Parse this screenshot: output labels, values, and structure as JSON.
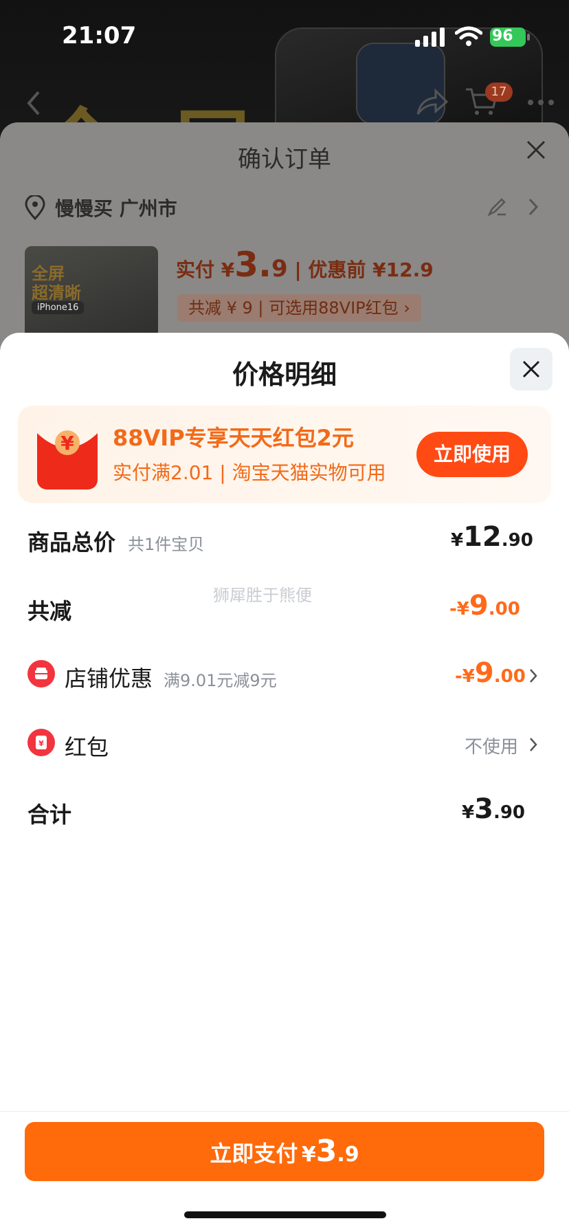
{
  "status_bar": {
    "time": "21:07",
    "battery": "96"
  },
  "background_header": {
    "big_text": "全屋",
    "cart_count": "17"
  },
  "order_sheet": {
    "title": "确认订单",
    "address": "慢慢买 广州市",
    "thumb_text": "全屏\n超清晰",
    "thumb_tag": "iPhone16",
    "paid_prefix": "实付 ¥",
    "paid_int": "3.",
    "paid_dec": "9",
    "before_discount": " | 优惠前 ¥12.9",
    "saved_chip": "共减 ¥ 9 | 可选用88VIP红包 ›"
  },
  "detail": {
    "title": "价格明细",
    "promo": {
      "title": "88VIP专享天天红包2元",
      "subtitle": "实付满2.01 | 淘宝天猫实物可用",
      "button": "立即使用"
    },
    "rows": {
      "total": {
        "label": "商品总价",
        "sub": "共1件宝贝",
        "sym": "¥",
        "int": "12",
        "dec": ".90"
      },
      "discount": {
        "label": "共减",
        "sym": "-¥",
        "int": "9",
        "dec": ".00"
      },
      "shop": {
        "label": "店铺优惠",
        "sub": "满9.01元减9元",
        "sym": "-¥",
        "int": "9",
        "dec": ".00"
      },
      "redpacket": {
        "label": "红包",
        "value": "不使用"
      },
      "sum": {
        "label": "合计",
        "sym": "¥",
        "int": "3",
        "dec": ".90"
      }
    },
    "watermark": "狮犀胜于熊便"
  },
  "pay_button": {
    "label": "立即支付",
    "sym": "¥",
    "int": "3",
    "dec": ".9"
  },
  "colors": {
    "accent": "#ff6a0a",
    "promo_button": "#ff4a14",
    "discount": "#ff6a1a",
    "shop_icon": "#f2343f"
  },
  "icons": [
    "signal-icon",
    "wifi-icon",
    "battery-icon",
    "back-icon",
    "share-icon",
    "cart-icon",
    "more-icon",
    "close-icon",
    "location-icon",
    "edit-icon",
    "chevron-right-icon",
    "red-envelope-icon",
    "shop-icon"
  ]
}
